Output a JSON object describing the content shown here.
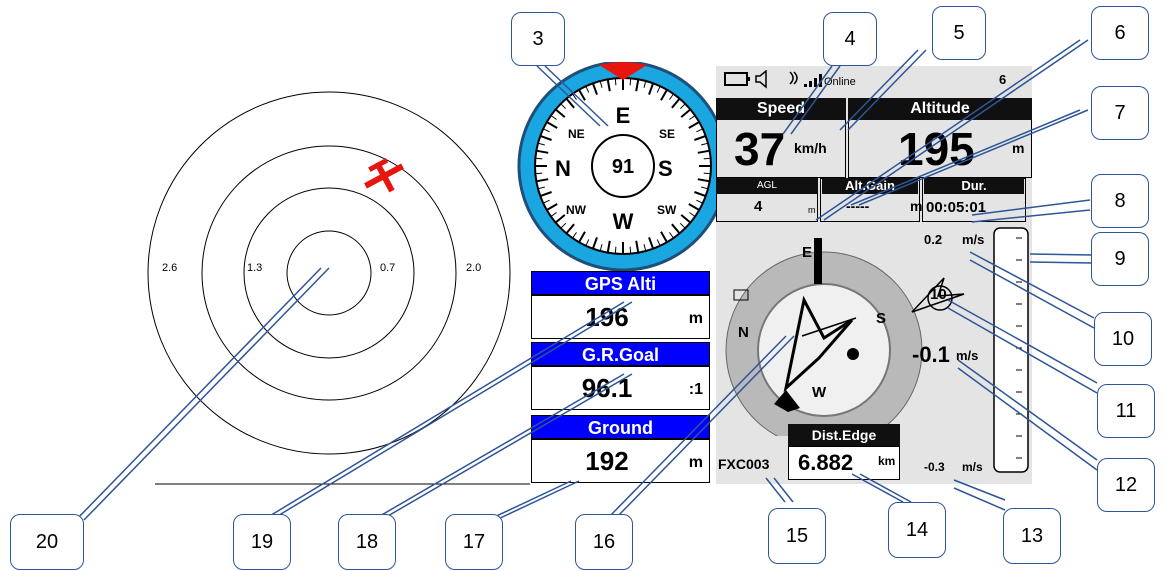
{
  "radar": {
    "ring_labels": [
      "2.6",
      "1.3",
      "0.7",
      "2.0"
    ]
  },
  "compass": {
    "heading": "91",
    "dirs": {
      "n": "N",
      "e": "E",
      "s": "S",
      "w": "W",
      "ne": "NE",
      "se": "SE",
      "nw": "NW",
      "sw": "SW"
    }
  },
  "panel": {
    "gps_alti": {
      "label": "GPS Alti",
      "value": "196",
      "unit": "m"
    },
    "gr_goal": {
      "label": "G.R.Goal",
      "value": "96.1",
      "unit": ":1"
    },
    "ground": {
      "label": "Ground",
      "value": "192",
      "unit": "m"
    }
  },
  "flight_display": {
    "status_online": "Online",
    "status_number": "6",
    "speed": {
      "label": "Speed",
      "value": "37",
      "unit": "km/h"
    },
    "altitude": {
      "label": "Altitude",
      "value": "195",
      "unit": "m"
    },
    "agl": {
      "label": "AGL",
      "value": "4",
      "unit": "m"
    },
    "alt_gain": {
      "label": "Alt.Gain",
      "value": "-----",
      "unit": "m"
    },
    "duration": {
      "label": "Dur.",
      "value": "00:05:01"
    },
    "vario_top": {
      "value": "0.2",
      "unit": "m/s"
    },
    "vario_current": {
      "value": "-0.1",
      "unit": "m/s"
    },
    "vario_bottom": {
      "value": "-0.3",
      "unit": "m/s"
    },
    "thermal_marker": "10",
    "nav_compass": {
      "n": "N",
      "e": "E",
      "s": "S",
      "w": "W"
    },
    "dist_edge": {
      "label": "Dist.Edge",
      "value": "6.882",
      "unit": "km"
    },
    "waypoint": "FXC003"
  },
  "callouts": [
    "3",
    "4",
    "5",
    "6",
    "7",
    "8",
    "9",
    "10",
    "11",
    "12",
    "13",
    "14",
    "15",
    "16",
    "17",
    "18",
    "19",
    "20"
  ]
}
